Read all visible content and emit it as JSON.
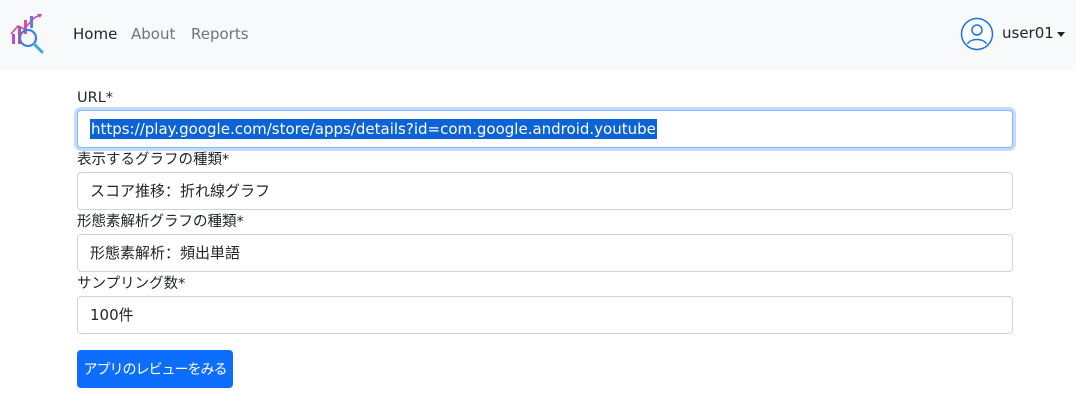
{
  "navbar": {
    "brand_icon": "chart-magnifier-logo",
    "links": [
      {
        "label": "Home",
        "active": true
      },
      {
        "label": "About",
        "active": false
      },
      {
        "label": "Reports",
        "active": false
      }
    ],
    "user": {
      "icon": "user-avatar-icon",
      "name": "user01"
    }
  },
  "form": {
    "url": {
      "label": "URL*",
      "value": "https://play.google.com/store/apps/details?id=com.google.android.youtube"
    },
    "graph_type": {
      "label": "表示するグラフの種類*",
      "value": "スコア推移：折れ線グラフ"
    },
    "morph_graph_type": {
      "label": "形態素解析グラフの種類*",
      "value": "形態素解析：頻出単語"
    },
    "sampling": {
      "label": "サンプリング数*",
      "value": "100件"
    },
    "submit_label": "アプリのレビューをみる"
  },
  "colors": {
    "primary": "#0d6efd",
    "navbar_bg": "#f8f9fa",
    "selection": "#0b63d6",
    "avatar_stroke": "#1a73e8"
  }
}
